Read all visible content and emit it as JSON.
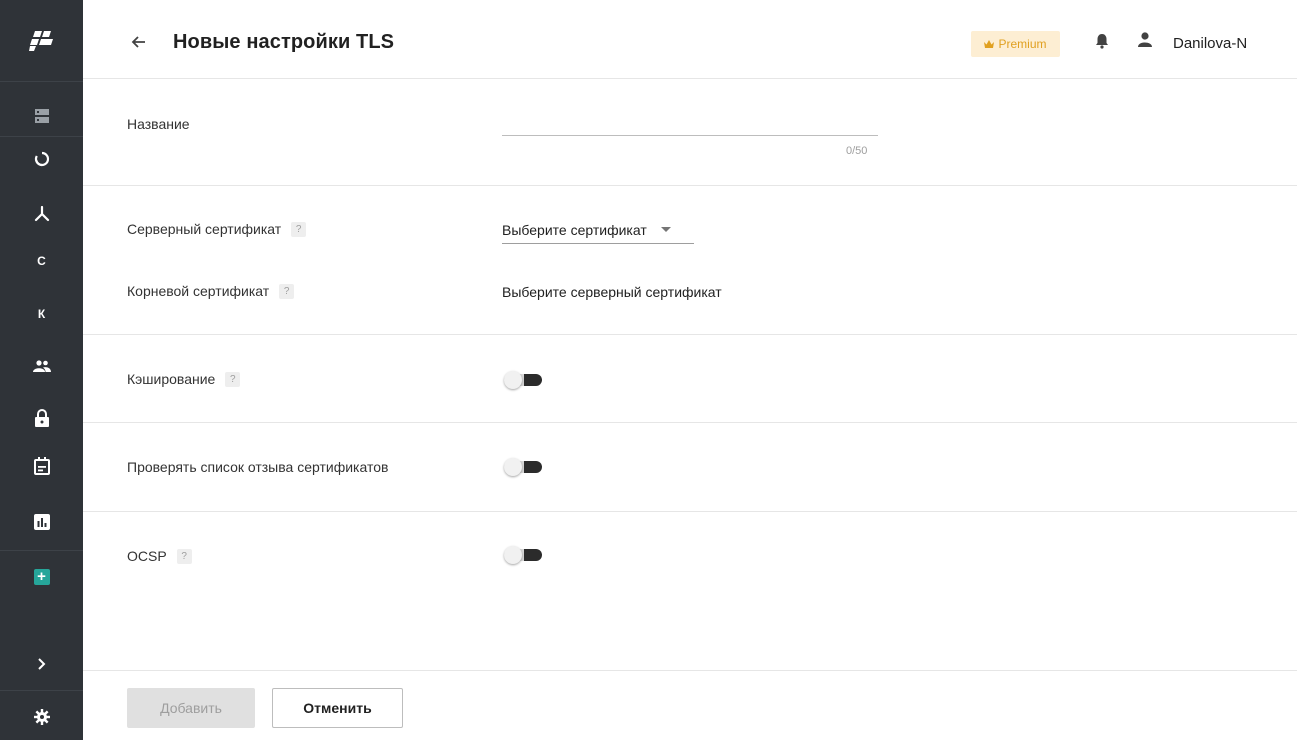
{
  "header": {
    "title": "Новые настройки TLS",
    "premium_label": "Premium",
    "user_name": "Danilova-N"
  },
  "sidebar": {
    "items": [
      {
        "icon": "server-icon"
      },
      {
        "icon": "circle-icon"
      },
      {
        "icon": "network-icon"
      },
      {
        "letter": "C"
      },
      {
        "letter": "К"
      },
      {
        "icon": "users-icon"
      },
      {
        "icon": "lock-icon"
      },
      {
        "icon": "calendar-icon"
      },
      {
        "icon": "chart-icon"
      },
      {
        "icon": "add-icon"
      },
      {
        "icon": "chevron-right-icon"
      },
      {
        "icon": "settings-icon"
      }
    ]
  },
  "form": {
    "name": {
      "label": "Название",
      "value": "",
      "counter": "0/50"
    },
    "server_cert": {
      "label": "Серверный сертификат",
      "placeholder": "Выберите сертификат"
    },
    "root_cert": {
      "label": "Корневой сертификат",
      "value": "Выберите серверный сертификат"
    },
    "caching": {
      "label": "Кэширование",
      "enabled": false
    },
    "crl_check": {
      "label": "Проверять список отзыва сертификатов",
      "enabled": false
    },
    "ocsp": {
      "label": "OCSP",
      "enabled": false
    },
    "help_mark": "?"
  },
  "footer": {
    "add_label": "Добавить",
    "cancel_label": "Отменить"
  },
  "colors": {
    "sidebar_bg": "#2f3338",
    "premium_bg": "#fdeed3",
    "premium_text": "#e0a020",
    "accent_teal": "#26a69a"
  }
}
